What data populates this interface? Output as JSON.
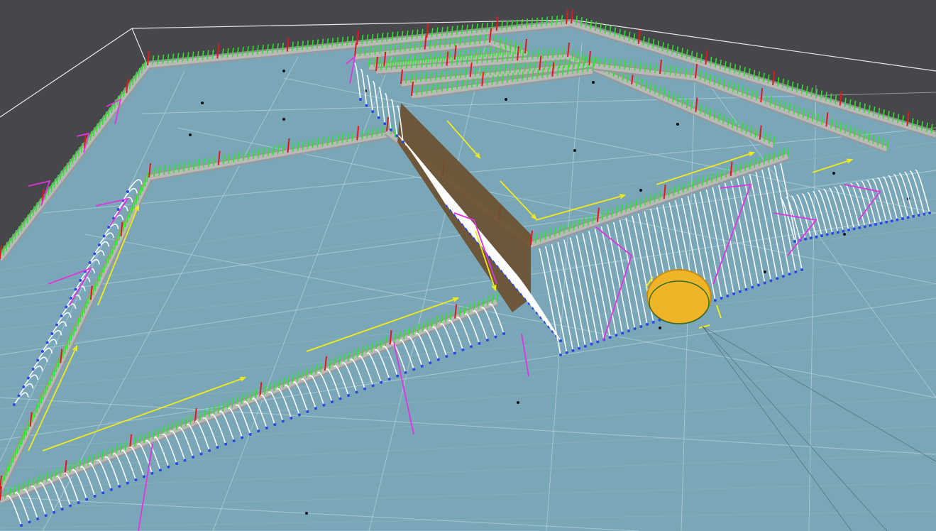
{
  "viewport": {
    "background_color": "#47464b",
    "floor_color": "#7aa7b8",
    "grid_color": "#c9dde4",
    "bounds_color": "#e8e8e8"
  },
  "legend_colors": {
    "wall": "#b9b9b9",
    "wall_dark": "#6b5030",
    "normal_vector": "#29e629",
    "marker": "#e01818",
    "path_arrow": "#f2ea18",
    "trajectory": "#ffffff",
    "contact_point": "#2a48e8",
    "waypoint_link": "#e034e0",
    "agent": "#f0b428",
    "node": "#111111"
  },
  "scene_objects": {
    "agent_name": "agent-disc",
    "icons": [
      "wall-segment",
      "normal-vector",
      "trajectory-arc",
      "contact-point",
      "waypoint-link",
      "path-arrow",
      "agent-disc",
      "grid-node"
    ]
  }
}
